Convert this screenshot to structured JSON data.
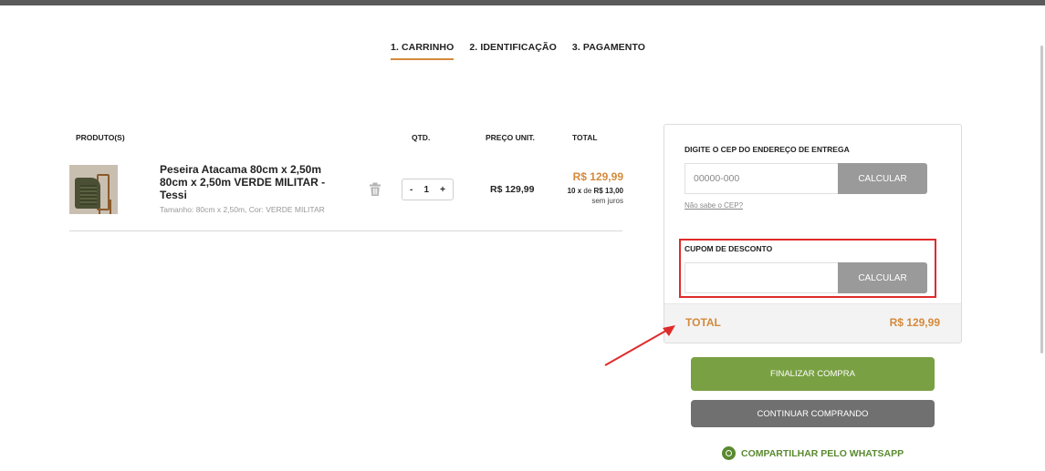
{
  "steps": [
    {
      "label": "1. CARRINHO",
      "active": true
    },
    {
      "label": "2. IDENTIFICAÇÃO",
      "active": false
    },
    {
      "label": "3. PAGAMENTO",
      "active": false
    }
  ],
  "cart": {
    "headers": {
      "product": "PRODUTO(S)",
      "qty": "QTD.",
      "unit_price": "PREÇO UNIT.",
      "total": "TOTAL"
    },
    "item": {
      "name": "Peseira Atacama 80cm x 2,50m 80cm x 2,50m VERDE MILITAR - Tessi",
      "variant": "Tamanho: 80cm x 2,50m, Cor: VERDE MILITAR",
      "qty": "1",
      "qty_minus": "-",
      "qty_plus": "+",
      "unit_price": "R$ 129,99",
      "total": "R$ 129,99",
      "installments_prefix": "10 x",
      "installments_mid": "de",
      "installments_value": "R$ 13,00",
      "installments_note": "sem juros"
    }
  },
  "shipping": {
    "label": "DIGITE O CEP DO ENDEREÇO DE ENTREGA",
    "placeholder": "00000-000",
    "button": "CALCULAR",
    "help_link": "Não sabe o CEP?"
  },
  "coupon": {
    "label": "CUPOM DE DESCONTO",
    "value": "",
    "button": "CALCULAR"
  },
  "summary": {
    "total_label": "TOTAL",
    "total_value": "R$ 129,99"
  },
  "actions": {
    "checkout": "FINALIZAR COMPRA",
    "continue": "CONTINUAR COMPRANDO",
    "whatsapp": "COMPARTILHAR PELO WHATSAPP"
  },
  "colors": {
    "accent": "#d48a3b",
    "green": "#79a042",
    "annotation": "#e02b2b"
  }
}
